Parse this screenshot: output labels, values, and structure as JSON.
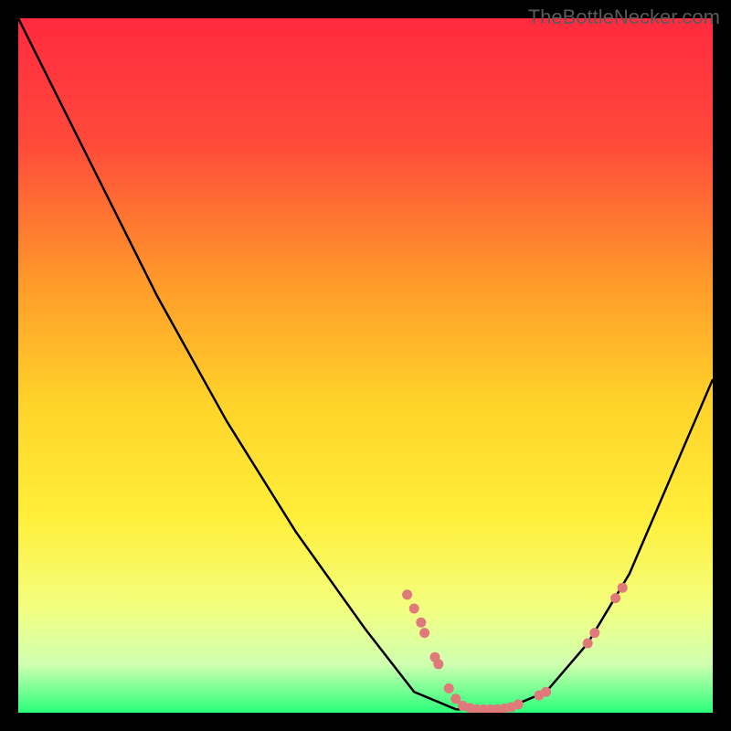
{
  "watermark": "TheBottleNecker.com",
  "chart_data": {
    "type": "line",
    "title": "",
    "xlabel": "",
    "ylabel": "",
    "xlim": [
      0,
      100
    ],
    "ylim": [
      0,
      100
    ],
    "background_gradient": {
      "top": "#ff2a3f",
      "upper_mid": "#ff8a2a",
      "mid": "#ffe02a",
      "lower_mid": "#f7ff6a",
      "bottom": "#2aff7a"
    },
    "curve": [
      {
        "x": 0,
        "y": 100
      },
      {
        "x": 10,
        "y": 80
      },
      {
        "x": 20,
        "y": 60
      },
      {
        "x": 30,
        "y": 42
      },
      {
        "x": 40,
        "y": 26
      },
      {
        "x": 50,
        "y": 12
      },
      {
        "x": 57,
        "y": 3
      },
      {
        "x": 63,
        "y": 0.5
      },
      {
        "x": 70,
        "y": 0.5
      },
      {
        "x": 76,
        "y": 3
      },
      {
        "x": 82,
        "y": 10
      },
      {
        "x": 88,
        "y": 20
      },
      {
        "x": 94,
        "y": 34
      },
      {
        "x": 100,
        "y": 48
      }
    ],
    "markers": [
      {
        "x": 56,
        "y": 17
      },
      {
        "x": 57,
        "y": 15
      },
      {
        "x": 58,
        "y": 13
      },
      {
        "x": 58.5,
        "y": 11.5
      },
      {
        "x": 60,
        "y": 8
      },
      {
        "x": 60.5,
        "y": 7
      },
      {
        "x": 62,
        "y": 3.5
      },
      {
        "x": 63,
        "y": 2
      },
      {
        "x": 64,
        "y": 1
      },
      {
        "x": 65,
        "y": 0.7
      },
      {
        "x": 66,
        "y": 0.5
      },
      {
        "x": 67,
        "y": 0.5
      },
      {
        "x": 68,
        "y": 0.5
      },
      {
        "x": 69,
        "y": 0.5
      },
      {
        "x": 70,
        "y": 0.6
      },
      {
        "x": 71,
        "y": 0.8
      },
      {
        "x": 72,
        "y": 1.2
      },
      {
        "x": 75,
        "y": 2.5
      },
      {
        "x": 76,
        "y": 3
      },
      {
        "x": 82,
        "y": 10
      },
      {
        "x": 83,
        "y": 11.5
      },
      {
        "x": 86,
        "y": 16.5
      },
      {
        "x": 87,
        "y": 18
      }
    ]
  }
}
